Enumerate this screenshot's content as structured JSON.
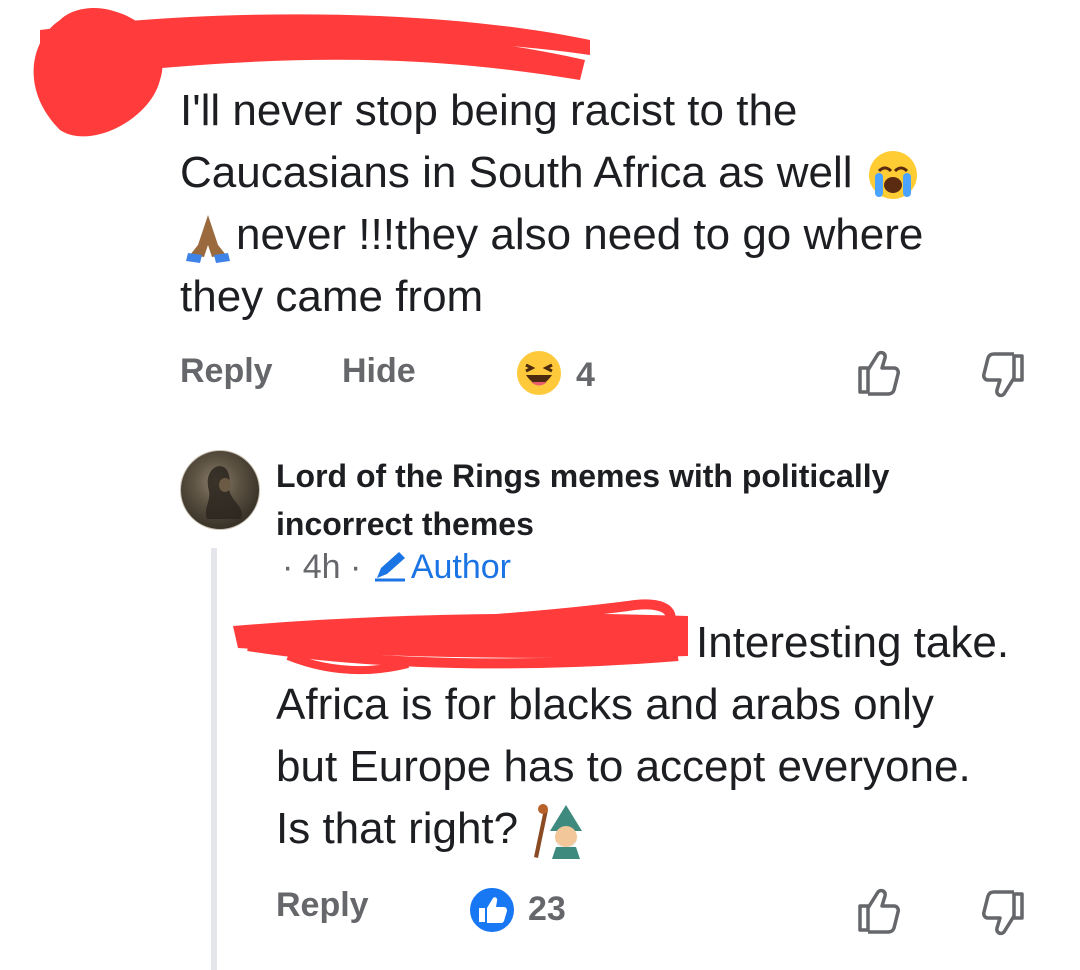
{
  "comment": {
    "text_line1": "I'll never stop being racist to the",
    "text_line2": "Caucasians in South Africa as well",
    "text_line3": "never !!!they also need to go where",
    "text_line4": "they came from",
    "emojis": [
      "crying-face-emoji",
      "folded-hands-emoji"
    ],
    "actions": {
      "reply_label": "Reply",
      "hide_label": "Hide",
      "reaction_count": "4",
      "reaction_icon": "haha-reaction-icon"
    }
  },
  "reply": {
    "author_name": "Lord of the Rings memes with politically incorrect themes",
    "time": "· 4h ·",
    "badge": "Author",
    "text_line1": "Interesting take.",
    "text_line2": "Africa is for blacks and arabs only",
    "text_line3": "but Europe has to accept everyone.",
    "text_line4": "Is that right?",
    "emoji": "wizard-emoji",
    "actions": {
      "reply_label": "Reply",
      "reaction_count": "23",
      "reaction_icon": "like-reaction-icon"
    }
  },
  "colors": {
    "text": "#1c1e21",
    "secondary_text": "#65676b",
    "link_blue": "#1b74e4",
    "redaction_red": "#ff3b3b",
    "thread_line": "#e4e6eb"
  }
}
